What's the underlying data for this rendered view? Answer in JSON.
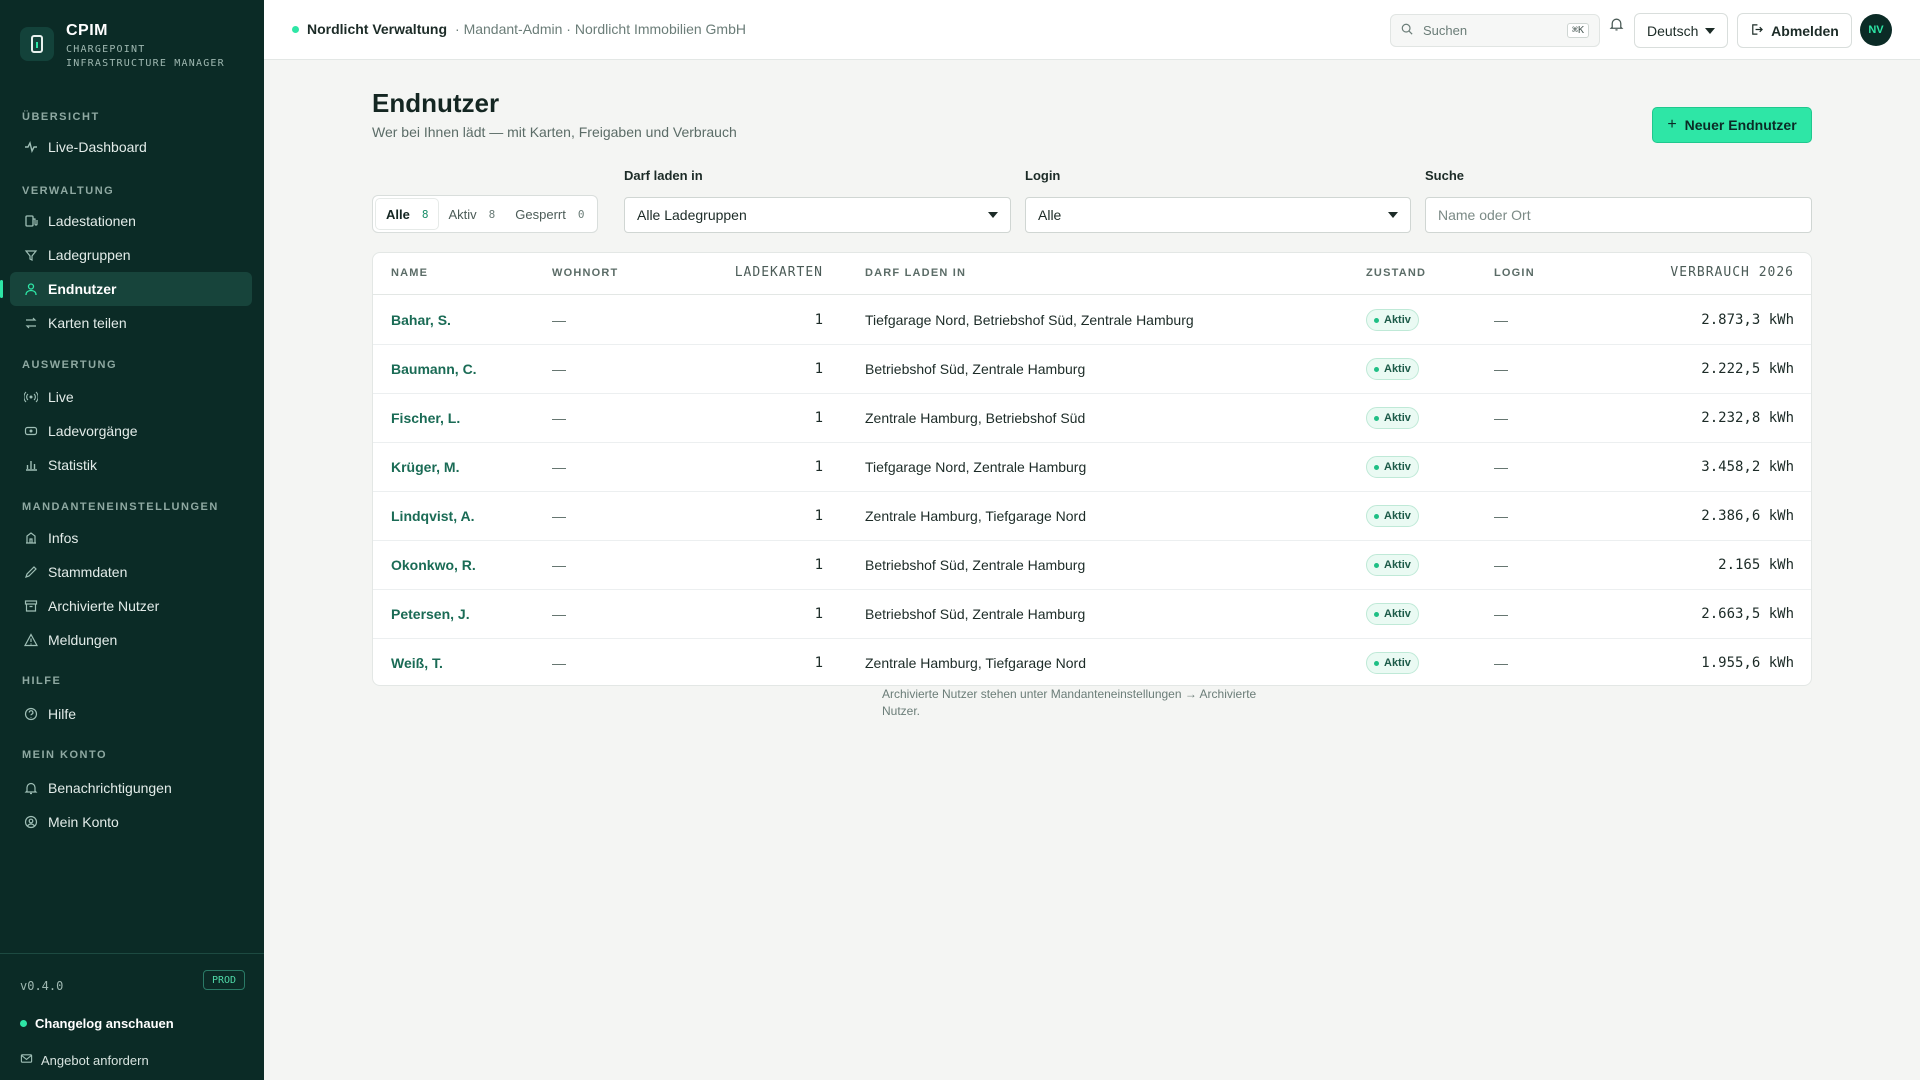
{
  "brand": {
    "title": "CPIM",
    "subtitle": "CHARGEPOINT INFRASTRUCTURE MANAGER"
  },
  "sidebar": {
    "sections": [
      {
        "label": "ÜBERSICHT",
        "items": [
          {
            "label": "Live-Dashboard",
            "icon": "activity-icon"
          }
        ]
      },
      {
        "label": "VERWALTUNG",
        "items": [
          {
            "label": "Ladestationen",
            "icon": "charging-station-icon"
          },
          {
            "label": "Ladegruppen",
            "icon": "group-icon"
          },
          {
            "label": "Endnutzer",
            "icon": "user-icon",
            "active": true
          },
          {
            "label": "Karten teilen",
            "icon": "share-icon"
          }
        ]
      },
      {
        "label": "AUSWERTUNG",
        "items": [
          {
            "label": "Live",
            "icon": "broadcast-icon"
          },
          {
            "label": "Ladevorgänge",
            "icon": "session-icon"
          },
          {
            "label": "Statistik",
            "icon": "bar-chart-icon"
          }
        ]
      },
      {
        "label": "MANDANTENEINSTELLUNGEN",
        "items": [
          {
            "label": "Infos",
            "icon": "building-icon"
          },
          {
            "label": "Stammdaten",
            "icon": "pencil-icon"
          },
          {
            "label": "Archivierte Nutzer",
            "icon": "archive-icon"
          },
          {
            "label": "Meldungen",
            "icon": "warning-icon"
          }
        ]
      },
      {
        "label": "HILFE",
        "items": [
          {
            "label": "Hilfe",
            "icon": "help-icon"
          }
        ]
      },
      {
        "label": "MEIN KONTO",
        "items": [
          {
            "label": "Benachrichtigungen",
            "icon": "bell-icon"
          },
          {
            "label": "Mein Konto",
            "icon": "account-icon"
          }
        ]
      }
    ],
    "footer": {
      "version": "v0.4.0",
      "env": "PROD",
      "changelog": "Changelog anschauen",
      "offer": "Angebot anfordern"
    }
  },
  "topbar": {
    "tenant_name": "Nordlicht Verwaltung",
    "tenant_meta": "· Mandant-Admin · Nordlicht Immobilien GmbH",
    "search_placeholder": "Suchen",
    "search_shortcut": "⌘K",
    "language": "Deutsch",
    "logout": "Abmelden",
    "avatar_initials": "NV"
  },
  "page": {
    "title": "Endnutzer",
    "subtitle": "Wer bei Ihnen lädt — mit Karten, Freigaben und Verbrauch",
    "new_button": "Neuer Endnutzer"
  },
  "filters": {
    "status_tabs": [
      {
        "label": "Alle",
        "count": "8",
        "active": true
      },
      {
        "label": "Aktiv",
        "count": "8"
      },
      {
        "label": "Gesperrt",
        "count": "0"
      }
    ],
    "group_label": "Darf laden in",
    "group_value": "Alle Ladegruppen",
    "login_label": "Login",
    "login_value": "Alle",
    "search_label": "Suche",
    "search_placeholder": "Name oder Ort"
  },
  "table": {
    "headers": {
      "name": "NAME",
      "wohnort": "WOHNORT",
      "ladekarten": "LADEKARTEN",
      "darf": "DARF LADEN IN",
      "zustand": "ZUSTAND",
      "login": "LOGIN",
      "verbrauch": "VERBRAUCH 2026"
    },
    "rows": [
      {
        "name": "Bahar, S.",
        "wohnort": "—",
        "cards": "1",
        "groups": "Tiefgarage Nord, Betriebshof Süd, Zentrale Hamburg",
        "status": "Aktiv",
        "login": "—",
        "usage": "2.873,3 kWh"
      },
      {
        "name": "Baumann, C.",
        "wohnort": "—",
        "cards": "1",
        "groups": "Betriebshof Süd, Zentrale Hamburg",
        "status": "Aktiv",
        "login": "—",
        "usage": "2.222,5 kWh"
      },
      {
        "name": "Fischer, L.",
        "wohnort": "—",
        "cards": "1",
        "groups": "Zentrale Hamburg, Betriebshof Süd",
        "status": "Aktiv",
        "login": "—",
        "usage": "2.232,8 kWh"
      },
      {
        "name": "Krüger, M.",
        "wohnort": "—",
        "cards": "1",
        "groups": "Tiefgarage Nord, Zentrale Hamburg",
        "status": "Aktiv",
        "login": "—",
        "usage": "3.458,2 kWh"
      },
      {
        "name": "Lindqvist, A.",
        "wohnort": "—",
        "cards": "1",
        "groups": "Zentrale Hamburg, Tiefgarage Nord",
        "status": "Aktiv",
        "login": "—",
        "usage": "2.386,6 kWh"
      },
      {
        "name": "Okonkwo, R.",
        "wohnort": "—",
        "cards": "1",
        "groups": "Betriebshof Süd, Zentrale Hamburg",
        "status": "Aktiv",
        "login": "—",
        "usage": "2.165 kWh"
      },
      {
        "name": "Petersen, J.",
        "wohnort": "—",
        "cards": "1",
        "groups": "Betriebshof Süd, Zentrale Hamburg",
        "status": "Aktiv",
        "login": "—",
        "usage": "2.663,5 kWh"
      },
      {
        "name": "Weiß, T.",
        "wohnort": "—",
        "cards": "1",
        "groups": "Zentrale Hamburg, Tiefgarage Nord",
        "status": "Aktiv",
        "login": "—",
        "usage": "1.955,6 kWh"
      }
    ]
  },
  "footnote": "Archivierte Nutzer stehen unter Mandanteneinstellungen → Archivierte Nutzer.",
  "colors": {
    "sidebar_bg": "#0b2b26",
    "accent": "#2ee6a6",
    "link": "#1a6b55"
  }
}
